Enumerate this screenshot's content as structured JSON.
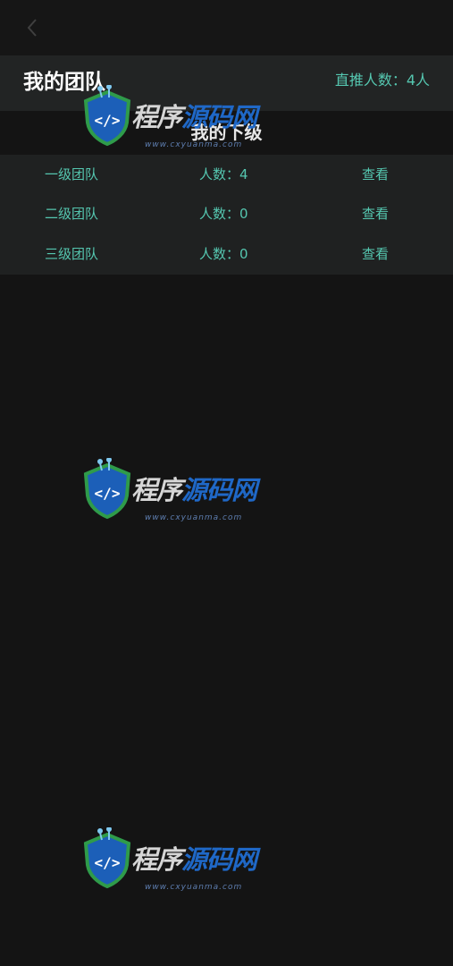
{
  "header": {
    "title": "我的团队",
    "direct_count": "直推人数：4人"
  },
  "section": {
    "subtitle": "我的下级"
  },
  "teams": [
    {
      "level": "一级团队",
      "count": "人数：4",
      "action": "查看"
    },
    {
      "level": "二级团队",
      "count": "人数：0",
      "action": "查看"
    },
    {
      "level": "三级团队",
      "count": "人数：0",
      "action": "查看"
    }
  ],
  "watermark": {
    "text_part1": "程序",
    "text_part2": "源码网",
    "url": "www.cxyuanma.com"
  },
  "colors": {
    "background": "#141414",
    "accent": "#55c7b0",
    "panel": "#222424"
  }
}
